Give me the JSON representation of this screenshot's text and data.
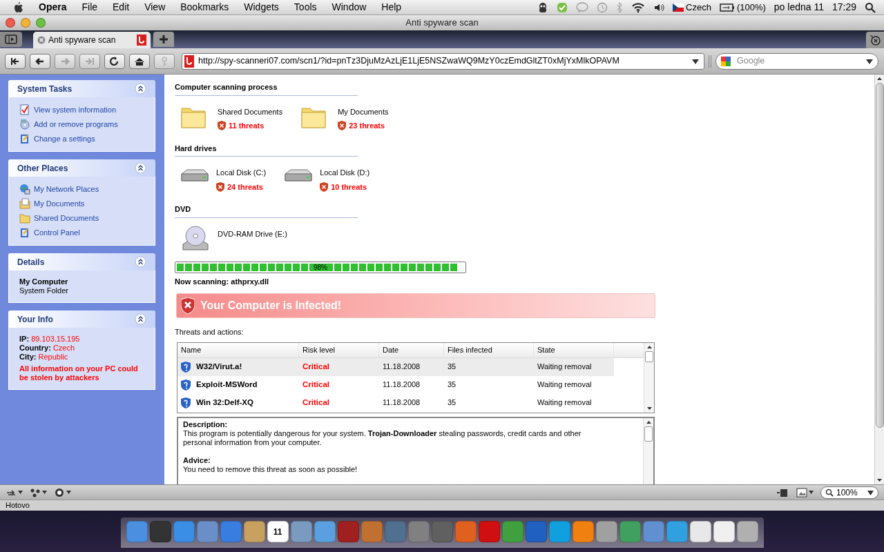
{
  "menu_bar": {
    "app": "Opera",
    "items": [
      "File",
      "Edit",
      "View",
      "Bookmarks",
      "Widgets",
      "Tools",
      "Window",
      "Help"
    ],
    "language": "Czech",
    "battery": "(100%)",
    "date": "po ledna 11",
    "time": "17:29"
  },
  "window": {
    "title": "Anti spyware scan"
  },
  "tabs": [
    {
      "label": "Anti spyware scan",
      "selected": true
    }
  ],
  "address_bar": {
    "url": "http://spy-scanneri07.com/scn1/?id=pnTz3DjuMzAzLjE1LjE5NSZwaWQ9MzY0czEmdGltZT0xMjYxMlkOPAVM"
  },
  "search": {
    "placeholder": "Google"
  },
  "sidebar": {
    "panels": [
      {
        "kind": "links",
        "title": "System Tasks",
        "expanded": true,
        "items": [
          {
            "label": "View system information"
          },
          {
            "label": "Add or remove programs"
          },
          {
            "label": "Change a settings"
          }
        ]
      },
      {
        "kind": "links",
        "title": "Other Places",
        "expanded": true,
        "items": [
          {
            "label": "My Network Places"
          },
          {
            "label": "My Documents"
          },
          {
            "label": "Shared Documents"
          },
          {
            "label": "Control Panel"
          }
        ]
      },
      {
        "kind": "details",
        "title": "Details",
        "expanded": true,
        "name": "My Computer",
        "subtitle": "System Folder"
      },
      {
        "kind": "info",
        "title": "Your Info",
        "expanded": true,
        "rows": [
          {
            "label": "IP:",
            "value": "89.103.15.195"
          },
          {
            "label": "Country:",
            "value": "Czech"
          },
          {
            "label": "City:",
            "value": "Republic"
          }
        ],
        "warning": "All information on your PC could be stolen by attackers"
      }
    ]
  },
  "scan": {
    "sections": [
      {
        "title": "Computer scanning process",
        "items": [
          {
            "kind": "folder",
            "name": "Shared Documents",
            "threats": "11 threats"
          },
          {
            "kind": "folder",
            "name": "My Documents",
            "threats": "23 threats"
          }
        ]
      },
      {
        "title": "Hard drives",
        "items": [
          {
            "kind": "disk",
            "name": "Local Disk (C:)",
            "threats": "24 threats"
          },
          {
            "kind": "disk",
            "name": "Local Disk (D:)",
            "threats": "10 threats"
          }
        ]
      },
      {
        "title": "DVD",
        "items": [
          {
            "kind": "dvd",
            "name": "DVD-RAM Drive (E:)"
          }
        ]
      }
    ],
    "progress": {
      "level": 0.98,
      "label": "98%"
    },
    "now_scanning": "Now scanning: athprxy.dll"
  },
  "alert": "Your Computer is Infected!",
  "threats_label": "Threats and actions:",
  "table": {
    "columns": [
      "Name",
      "Risk level",
      "Date",
      "Files infected",
      "State"
    ],
    "rows": [
      {
        "name": "W32/Virut.a!",
        "risk": "Critical",
        "date": "11.18.2008",
        "files": "35",
        "state": "Waiting removal",
        "selected": true
      },
      {
        "name": "Exploit-MSWord",
        "risk": "Critical",
        "date": "11.18.2008",
        "files": "35",
        "state": "Waiting removal",
        "selected": false
      },
      {
        "name": "Win 32:Delf-XQ",
        "risk": "Critical",
        "date": "11.18.2008",
        "files": "35",
        "state": "Waiting removal",
        "selected": false
      }
    ]
  },
  "description": {
    "heading": "Description:",
    "text": "This program is potentially dangerous for your system. **Trojan-Downloader** stealing passwords, credit cards and other personal information from your computer.",
    "advice_heading": "Advice:",
    "advice": "You need to remove this threat as soon as possible!"
  },
  "zoom": "100%",
  "status_bar": "Hotovo",
  "dock": [
    {
      "color": "#4a8fe0"
    },
    {
      "color": "#333333"
    },
    {
      "color": "#3a8ee6"
    },
    {
      "color": "#6a8fc8"
    },
    {
      "color": "#3a7de0"
    },
    {
      "color": "#c8a060"
    },
    {
      "color": "#ffffff",
      "label": "11"
    },
    {
      "color": "#7a9ac0"
    },
    {
      "color": "#5aa0e0"
    },
    {
      "color": "#a02020"
    },
    {
      "color": "#c07030"
    },
    {
      "color": "#507090"
    },
    {
      "color": "#808080"
    },
    {
      "color": "#606060"
    },
    {
      "color": "#e06020"
    },
    {
      "color": "#d01010"
    },
    {
      "color": "#40a040"
    },
    {
      "color": "#2060c0"
    },
    {
      "color": "#10a0e0"
    },
    {
      "color": "#f08010"
    },
    {
      "color": "#a0a0a0"
    },
    {
      "color": "#40a060"
    },
    {
      "color": "#6090d0"
    },
    {
      "color": "#30a0e0"
    },
    {
      "color": "#e8e8e8"
    },
    {
      "color": "#f0f0f0"
    },
    {
      "color": "#b0b0b0"
    }
  ]
}
